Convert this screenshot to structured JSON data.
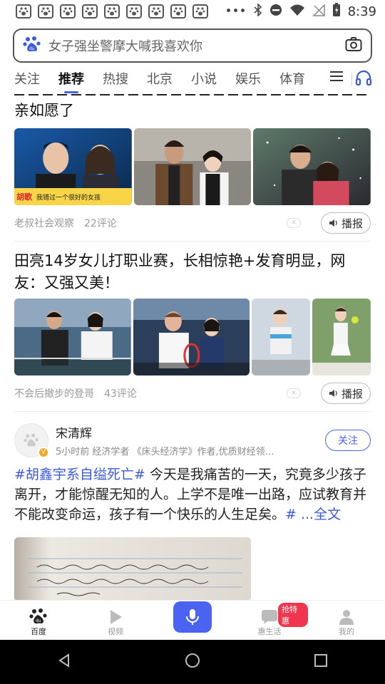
{
  "status": {
    "time": "8:39"
  },
  "search": {
    "placeholder": "女子强坐警摩大喊我喜欢你"
  },
  "tabs": [
    "关注",
    "推荐",
    "热搜",
    "北京",
    "小说",
    "娱乐",
    "体育"
  ],
  "feed": [
    {
      "title_partial": "亲如愿了",
      "images": [
        {
          "caption_name": "胡歌",
          "caption_text": "我错过一个很好的女孩"
        },
        {},
        {}
      ],
      "source": "老叔社会观察",
      "comments": "22评论",
      "broadcast": "播报"
    },
    {
      "title": "田亮14岁女儿打职业赛，长相惊艳+发育明显，网友：又强又美！",
      "source": "不会后撤步的登哥",
      "comments": "43评论",
      "broadcast": "播报"
    }
  ],
  "post": {
    "author": "宋清辉",
    "meta": "5小时前   经济学者 《床头经济学》作者,优质财经领…",
    "follow": "关注",
    "hashtag": "#胡鑫宇系自缢死亡#",
    "text": " 今天是我痛苦的一天，究竟多少孩子离开，才能惊醒无知的人。上学不是唯一出路，应试教育并不能改变命运，孩子有一个快乐的人生足矣。",
    "more": "# ...全文"
  },
  "bottom_nav": [
    {
      "label": "百度"
    },
    {
      "label": "视频"
    },
    {
      "label": ""
    },
    {
      "label": "惠生活",
      "badge": "抢特惠"
    },
    {
      "label": "我的"
    }
  ]
}
